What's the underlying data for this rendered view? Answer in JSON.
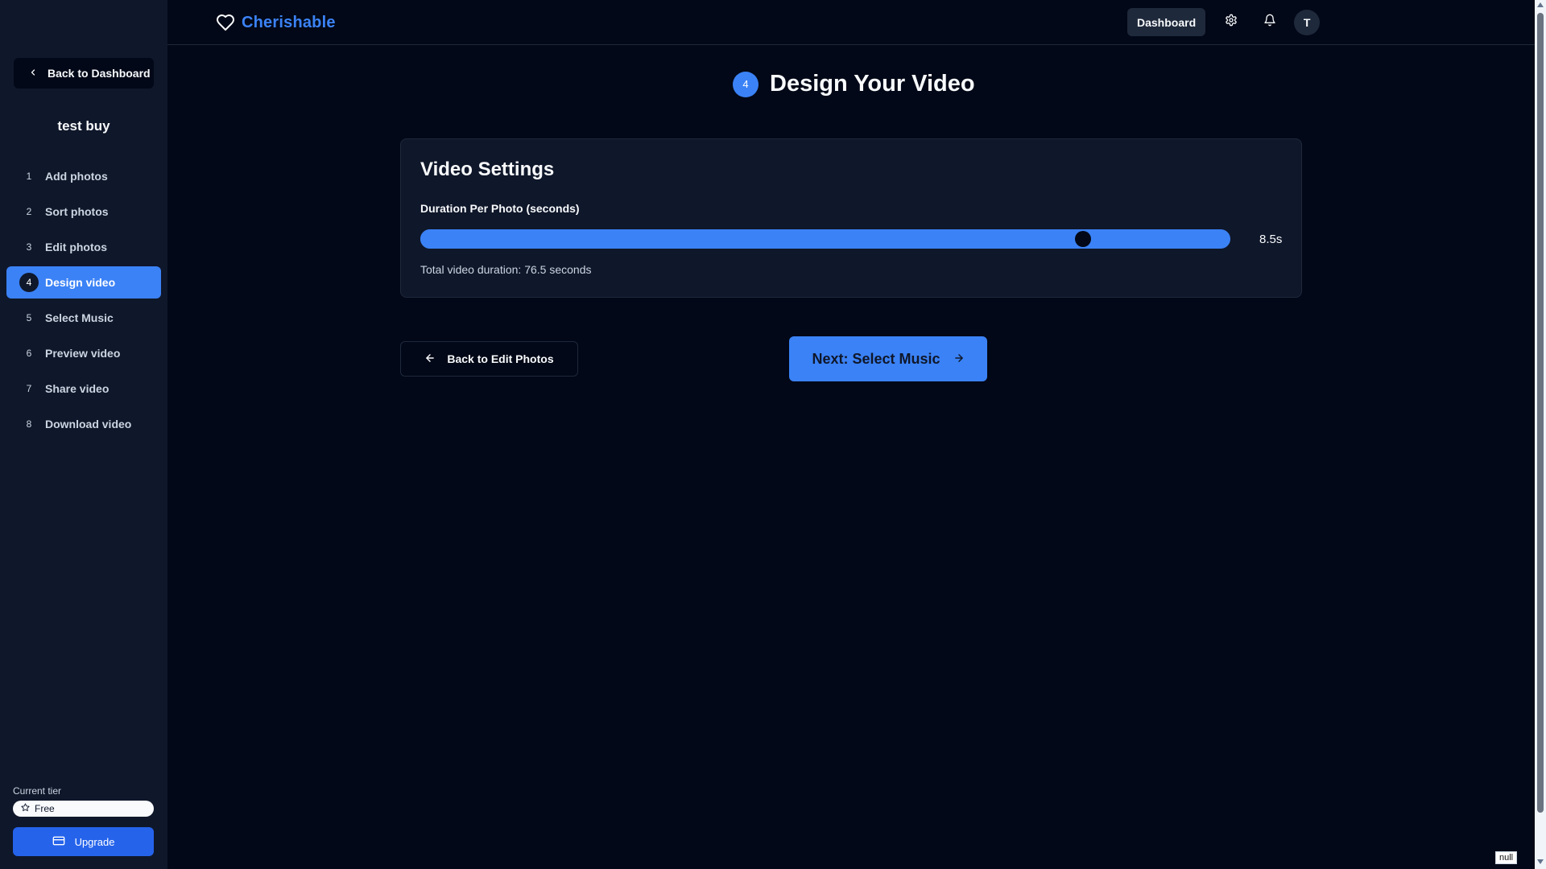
{
  "app": {
    "brand": "Cherishable",
    "colors": {
      "accent": "#3b82f6",
      "background": "#020817",
      "panel": "#0f172a",
      "border": "#1e293b"
    }
  },
  "header": {
    "dashboard_label": "Dashboard",
    "avatar_initial": "T",
    "icons": [
      "heart-icon",
      "gear-icon",
      "bell-icon"
    ]
  },
  "sidebar": {
    "back_label": "Back to Dashboard",
    "project_title": "test buy",
    "steps": [
      {
        "num": "1",
        "label": "Add photos"
      },
      {
        "num": "2",
        "label": "Sort photos"
      },
      {
        "num": "3",
        "label": "Edit photos"
      },
      {
        "num": "4",
        "label": "Design video",
        "active": true
      },
      {
        "num": "5",
        "label": "Select Music"
      },
      {
        "num": "6",
        "label": "Preview video"
      },
      {
        "num": "7",
        "label": "Share video"
      },
      {
        "num": "8",
        "label": "Download video"
      }
    ],
    "tier_label": "Current tier",
    "tier_value": "Free",
    "upgrade_label": "Upgrade"
  },
  "main": {
    "step_badge": "4",
    "title": "Design Your Video",
    "settings": {
      "title": "Video Settings",
      "duration_label": "Duration Per Photo (seconds)",
      "duration_value": "8.5s",
      "slider_fraction": 0.825,
      "total_text": "Total video duration: 76.5 seconds"
    },
    "back_button": "Back to Edit Photos",
    "next_button": "Next: Select Music"
  },
  "debug_tag": "null"
}
